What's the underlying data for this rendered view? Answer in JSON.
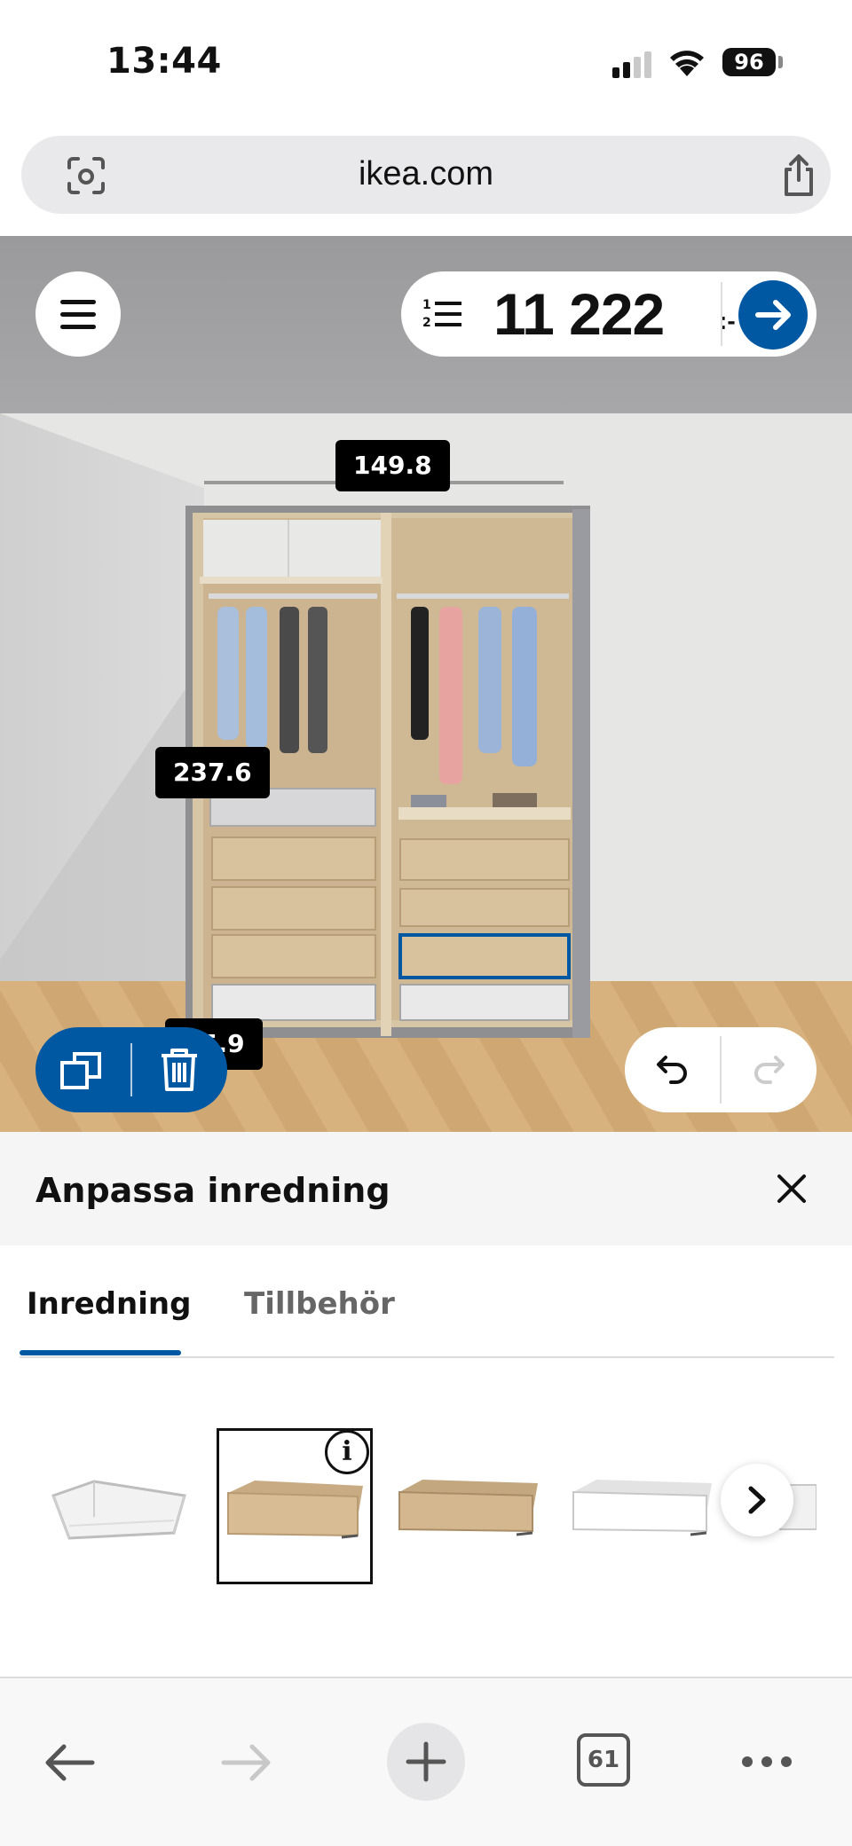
{
  "status_bar": {
    "time": "13:44",
    "battery": "96"
  },
  "browser": {
    "url": "ikea.com",
    "tab_count": "61"
  },
  "planner": {
    "price": "11 222",
    "price_suffix": ":-",
    "dimensions": {
      "width": "149.8",
      "height": "237.6",
      "depth": "5.9"
    }
  },
  "panel": {
    "title": "Anpassa inredning",
    "tabs": [
      {
        "label": "Inredning",
        "active": true
      },
      {
        "label": "Tillbehör",
        "active": false
      }
    ],
    "products": [
      {
        "name": "white-wire-basket",
        "selected": false
      },
      {
        "name": "oak-effect-drawer",
        "selected": true
      },
      {
        "name": "oak-effect-drawer-glass-front",
        "selected": false
      },
      {
        "name": "white-drawer",
        "selected": false
      }
    ]
  },
  "colors": {
    "accent": "#0058a3",
    "dimension_label_bg": "#000000"
  },
  "icons": [
    "scan-icon",
    "share-icon",
    "menu-icon",
    "list-icon",
    "arrow-right-icon",
    "duplicate-icon",
    "trash-icon",
    "undo-icon",
    "redo-icon",
    "close-icon",
    "info-icon",
    "chevron-right-icon",
    "back-arrow-icon",
    "forward-arrow-icon",
    "plus-icon",
    "tabs-icon",
    "more-icon"
  ]
}
